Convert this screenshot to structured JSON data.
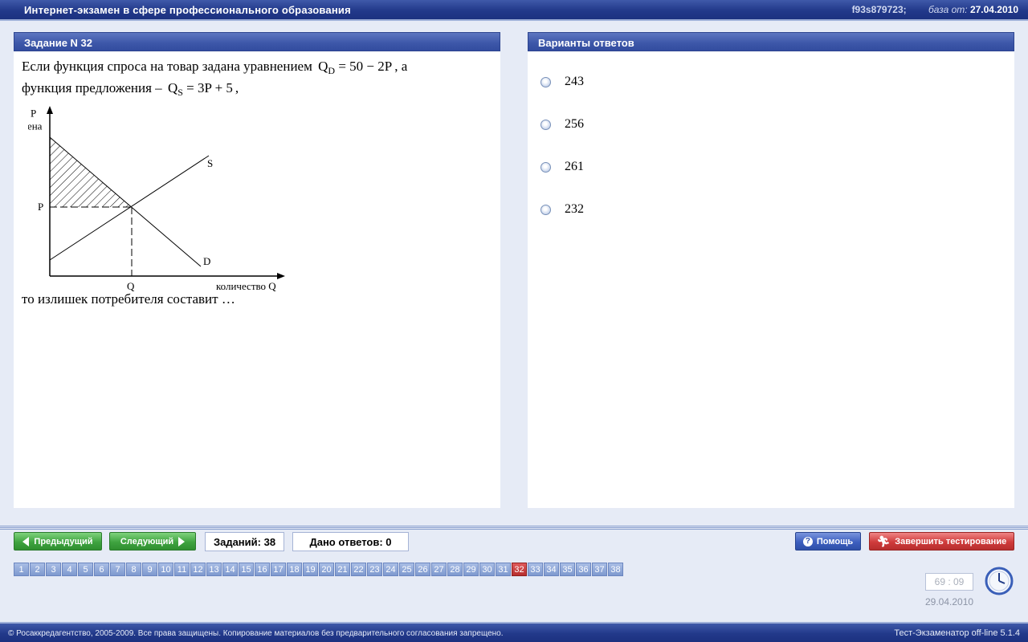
{
  "header": {
    "title": "Интернет-экзамен в сфере профессионального образования",
    "session_id": "f93s879723;",
    "db_label": "база от:",
    "db_date": "27.04.2010"
  },
  "question": {
    "header": "Задание N 32",
    "text_part1": "Если функция спроса на товар задана уравнением",
    "demand_symbol": "Q",
    "demand_sub": "D",
    "demand_eq": "= 50 − 2P",
    "text_part2": ", а",
    "text_part3": "функция предложения –",
    "supply_symbol": "Q",
    "supply_sub": "S",
    "supply_eq": "= 3P + 5",
    "text_part4": ",",
    "footer": "то излишек потребителя составит …"
  },
  "graph": {
    "y_axis_symbol": "P",
    "y_axis_label": "цена",
    "x_axis_label": "количество Q",
    "price_label": "P",
    "quantity_label": "Q",
    "supply_label": "S",
    "demand_label": "D"
  },
  "answers": {
    "header": "Варианты ответов",
    "options": [
      "243",
      "256",
      "261",
      "232"
    ]
  },
  "nav": {
    "prev_label": "Предыдущий",
    "next_label": "Следующий",
    "tasks_count": "Заданий: 38",
    "answers_given": "Дано ответов: 0",
    "help_label": "Помощь",
    "finish_label": "Завершить тестирование",
    "current_question": "32",
    "numbers": [
      "1",
      "2",
      "3",
      "4",
      "5",
      "6",
      "7",
      "8",
      "9",
      "10",
      "11",
      "12",
      "13",
      "14",
      "15",
      "16",
      "17",
      "18",
      "19",
      "20",
      "21",
      "22",
      "23",
      "24",
      "25",
      "26",
      "27",
      "28",
      "29",
      "30",
      "31",
      "32",
      "33",
      "34",
      "35",
      "36",
      "37",
      "38"
    ]
  },
  "timer": {
    "time": "69 : 09",
    "date": "29.04.2010"
  },
  "footer": {
    "copyright": "© Росаккредагентство, 2005-2009. Все права защищены. Копирование материалов без предварительного согласования запрещено.",
    "version": "Тест-Экзаменатор off-line 5.1.4"
  },
  "colors": {
    "bar_blue": "#22398a",
    "panel_header": "#3c56a8",
    "button_green": "#3fa340",
    "button_blue": "#3d5fbf",
    "button_red": "#cf3b3b",
    "active_question": "#b62d2d"
  }
}
